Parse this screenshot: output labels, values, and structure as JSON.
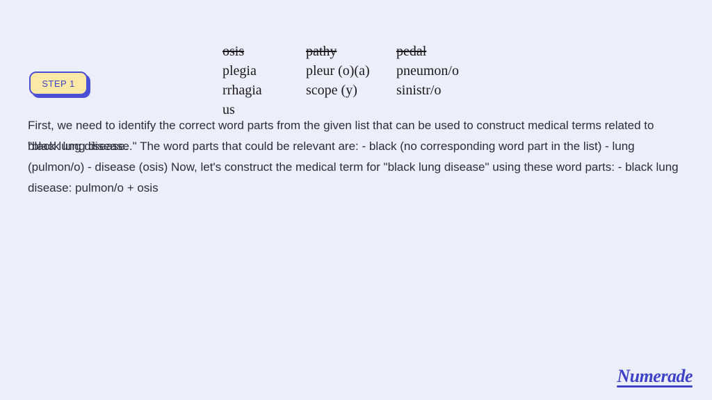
{
  "step_badge": "STEP 1",
  "word_table": {
    "row0": {
      "c1": "osis",
      "c2": "pathy",
      "c3": "pedal"
    },
    "row1": {
      "c1": "plegia",
      "c2": "pleur (o)(a)",
      "c3": "pneumon/o"
    },
    "row2": {
      "c1": "rrhagia",
      "c2": "scope (y)",
      "c3": "sinistr/o"
    },
    "row3": {
      "c1": "us"
    }
  },
  "explanation": "First, we need to identify the correct word parts from the given list that can be used to construct medical terms related to \"black lung disease.\" The word parts that could be relevant are: - black (no corresponding word part in the list) - lung (pulmon/o) - disease (osis) Now, let's construct the medical term for \"black lung disease\" using these word parts: - black lung disease: pulmon/o + osis",
  "overlay_text": "black lung disease.",
  "logo": "Numerade"
}
